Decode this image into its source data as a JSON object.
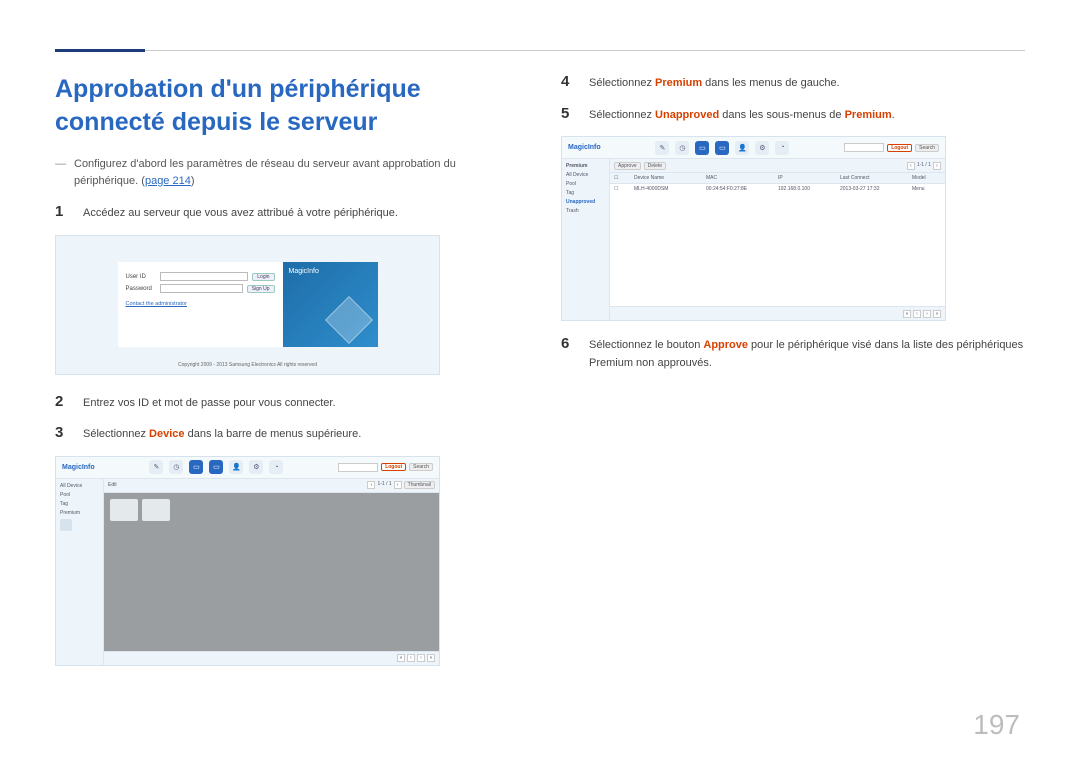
{
  "page_number": "197",
  "title": "Approbation d'un périphérique connecté depuis le serveur",
  "config_note": "Configurez d'abord les paramètres de réseau du serveur avant approbation du périphérique.",
  "page_link_label": "page 214",
  "steps": {
    "1": "Accédez au serveur que vous avez attribué à votre périphérique.",
    "2": "Entrez vos ID et mot de passe pour vous connecter.",
    "3_pre": "Sélectionnez ",
    "3_bold": "Device",
    "3_post": " dans la barre de menus supérieure.",
    "4_pre": "Sélectionnez ",
    "4_bold": "Premium",
    "4_post": " dans les menus de gauche.",
    "5_pre": "Sélectionnez ",
    "5_bold": "Unapproved",
    "5_post": " dans les sous-menus de ",
    "5_bold2": "Premium",
    "5_post2": ".",
    "6_pre": "Sélectionnez le bouton ",
    "6_bold": "Approve",
    "6_post": " pour le périphérique visé dans la liste des périphériques Premium non approuvés."
  },
  "login": {
    "brand": "MagicInfo",
    "user_label": "User ID",
    "pass_label": "Password",
    "login_btn": "Login",
    "signup_btn": "Sign Up",
    "contact": "Contact the administrator",
    "copyright": "Copyright 2009 - 2013 Samsung Electronics All rights reserved"
  },
  "shot": {
    "brand": "MagicInfo",
    "logout": "Logout",
    "search": "Search",
    "nav": [
      "Content",
      "Schedule",
      "Device",
      "User",
      "Setting",
      "Statistic",
      "Help"
    ],
    "sidebar_items": [
      "All Device",
      "Pool",
      "Tag",
      "Premium",
      "Unapproved",
      "Trash"
    ],
    "toolbar_left": "Edit",
    "thumb": "Thumbnail",
    "pager_info": "1-1 / 1",
    "approve": "Approve",
    "th": [
      "",
      "Device Name",
      "MAC",
      "IP",
      "Last Connect",
      "Model"
    ],
    "row": [
      "",
      "MLH-4000DSM",
      "00:24:54:F0:27:8E",
      "192.168.0.100",
      "2013-03-27 17:32",
      "Menu"
    ]
  }
}
